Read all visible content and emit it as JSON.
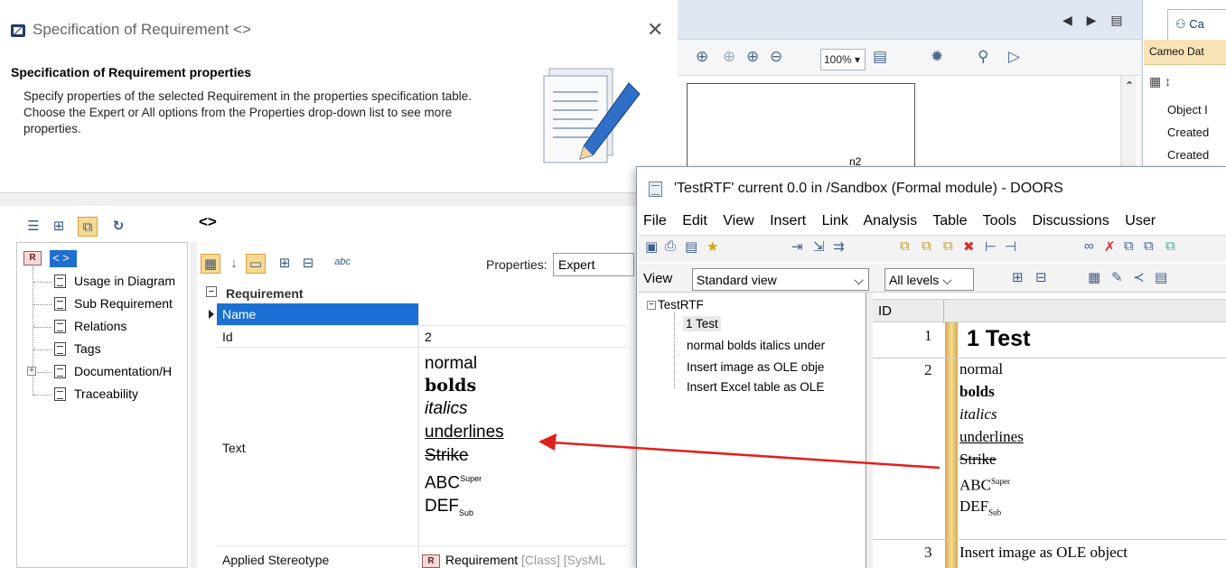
{
  "background_app": {
    "zoom": "100%",
    "right_tab_label": "Ca",
    "right_panel_title": "Cameo Dat",
    "right_panel_rows": [
      "Object I",
      "Created",
      "Created"
    ],
    "canvas_label": "n2"
  },
  "spec_dialog": {
    "title": "Specification of Requirement <>",
    "header_title": "Specification of Requirement properties",
    "header_desc": "Specify properties of the selected Requirement in the properties specification table. Choose the Expert or All options from the Properties drop-down list to see more properties.",
    "path_label": "<>",
    "tree": {
      "root_badge": "R",
      "root_label": "< >",
      "items": [
        {
          "label": "Usage in Diagram"
        },
        {
          "label": "Sub Requirement"
        },
        {
          "label": "Relations"
        },
        {
          "label": "Tags"
        },
        {
          "label": "Documentation/H"
        },
        {
          "label": "Traceability"
        }
      ]
    },
    "properties": {
      "filter_label": "Properties:",
      "filter_value": "Expert",
      "abc_icon_label": "abc",
      "section": "Requirement",
      "rows": {
        "name_key": "Name",
        "id_key": "Id",
        "id_value": "2",
        "text_key": "Text",
        "stereotype_key": "Applied Stereotype",
        "stereotype_badge": "R",
        "stereotype_value": "Requirement",
        "stereotype_suffix": "[Class] [SysML"
      },
      "text_value": {
        "normal": "normal",
        "bold": "bolds",
        "italic": "italics",
        "underline": "underlines",
        "strike": "Strike",
        "super_base": "ABC",
        "super": "Super",
        "sub_base": "DEF",
        "sub": "Sub"
      }
    }
  },
  "doors": {
    "title": "'TestRTF' current 0.0 in /Sandbox (Formal module) - DOORS",
    "menu": [
      "File",
      "Edit",
      "View",
      "Insert",
      "Link",
      "Analysis",
      "Table",
      "Tools",
      "Discussions",
      "User"
    ],
    "view_label": "View",
    "view_value": "Standard view",
    "levels_value": "All levels",
    "tree": {
      "root": "TestRTF",
      "items": [
        "1 Test",
        "normal bolds italics under",
        "Insert image as OLE obje",
        "Insert Excel table as OLE"
      ]
    },
    "grid": {
      "id_header": "ID",
      "rows": [
        {
          "id": "1",
          "heading": "1 Test"
        },
        {
          "id": "2"
        },
        {
          "id": "3",
          "text": "Insert image as OLE object"
        }
      ],
      "rich": {
        "normal": "normal",
        "bold": "bolds",
        "italic": "italics",
        "underline": "underlines",
        "strike": "Strike",
        "super_base": "ABC",
        "super": "Super",
        "sub_base": "DEF",
        "sub": "Sub"
      }
    }
  },
  "colors": {
    "selection": "#1c6fd2",
    "doors_gold": "#e3b75b",
    "arrow": "#e0201e"
  }
}
